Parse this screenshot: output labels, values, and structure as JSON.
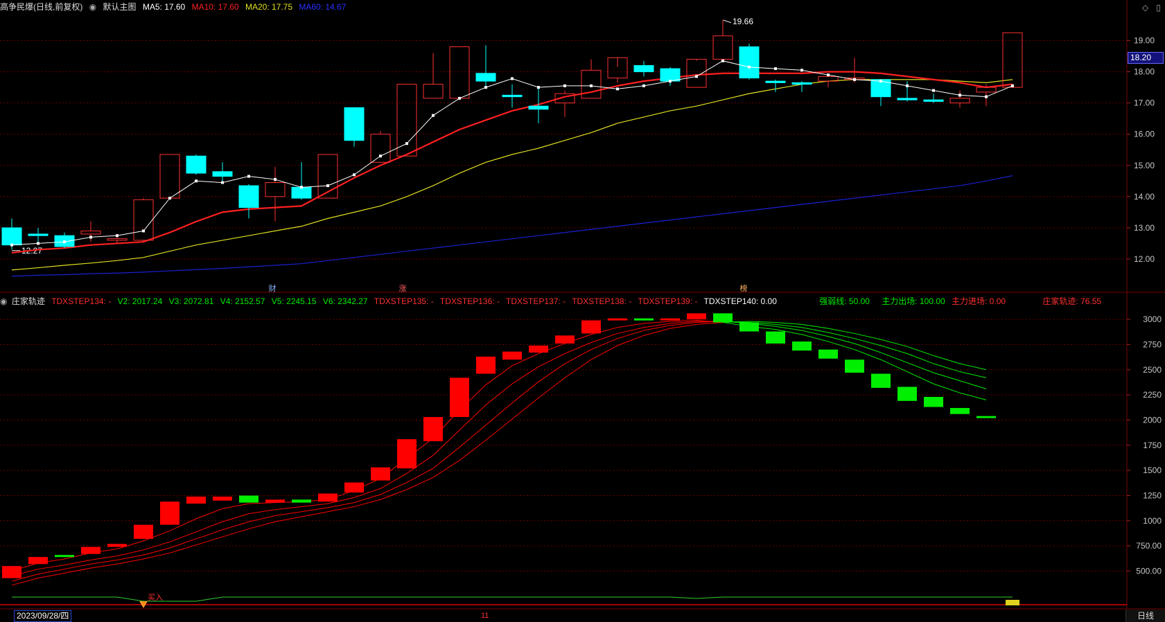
{
  "main_header": {
    "title": "高争民爆(日线,前复权)",
    "indicator_name": "默认主图",
    "ma5": "MA5: 17.60",
    "ma10": "MA10: 17.60",
    "ma20": "MA20: 17.75",
    "ma60": "MA60: 14.67"
  },
  "sub_header": {
    "title": "庄家轨迹",
    "step134": "TDXSTEP134: -",
    "v2": "V2: 2017.24",
    "v3": "V3: 2072.81",
    "v4": "V4: 2152.57",
    "v5": "V5: 2245.15",
    "v6": "V6: 2342.27",
    "step135": "TDXSTEP135: -",
    "step136": "TDXSTEP136: -",
    "step137": "TDXSTEP137: -",
    "step138": "TDXSTEP138: -",
    "step139": "TDXSTEP139: -",
    "step140": "TDXSTEP140: 0.00",
    "qrx": "强弱线: 50.00",
    "zlcc": "主力出场: 100.00",
    "zljc": "主力进场: 0.00",
    "zjgj": "庄家轨迹: 76.55"
  },
  "price_tag": "18.20",
  "high_label": "19.66",
  "low_label": "12.27",
  "events": [
    "财",
    "涨",
    "榜"
  ],
  "buy_marker": "买入",
  "date_label": "2023/09/28/四",
  "month_marker": "11",
  "period_tab": "日线",
  "colors": {
    "up": "#ff3030",
    "down": "#00ffff",
    "ma5": "#ffffff",
    "ma10": "#ff2020",
    "ma20": "#e0e020",
    "ma60": "#1a20d0",
    "sub_up": "#ff0000",
    "sub_down": "#00ee00"
  },
  "chart_data": {
    "type": "candlestick",
    "main": {
      "ylim": [
        11.2,
        19.9
      ],
      "yticks": [
        "12.00",
        "13.00",
        "14.00",
        "15.00",
        "16.00",
        "17.00",
        "18.00",
        "19.00"
      ],
      "candles": [
        [
          13.0,
          13.3,
          12.3,
          12.45
        ],
        [
          12.8,
          13.0,
          12.55,
          12.75
        ],
        [
          12.75,
          12.85,
          12.35,
          12.4
        ],
        [
          12.8,
          13.2,
          12.55,
          12.9
        ],
        [
          12.6,
          12.75,
          12.5,
          12.65
        ],
        [
          12.6,
          13.95,
          12.55,
          13.9
        ],
        [
          13.95,
          15.35,
          13.95,
          15.35
        ],
        [
          15.3,
          15.35,
          14.7,
          14.75
        ],
        [
          14.8,
          15.1,
          14.5,
          14.65
        ],
        [
          14.35,
          14.4,
          13.3,
          13.65
        ],
        [
          14.0,
          14.95,
          13.2,
          14.45
        ],
        [
          14.3,
          15.1,
          13.9,
          13.95
        ],
        [
          13.95,
          15.35,
          13.95,
          15.35
        ],
        [
          16.85,
          16.85,
          15.6,
          15.8
        ],
        [
          15.1,
          16.1,
          15.1,
          16.0
        ],
        [
          15.3,
          17.6,
          15.3,
          17.6
        ],
        [
          17.15,
          18.6,
          17.15,
          17.6
        ],
        [
          17.15,
          18.8,
          17.15,
          18.8
        ],
        [
          17.95,
          18.85,
          17.55,
          17.7
        ],
        [
          17.25,
          17.6,
          16.85,
          17.2
        ],
        [
          16.9,
          17.5,
          16.35,
          16.8
        ],
        [
          17.0,
          17.4,
          16.55,
          17.3
        ],
        [
          17.15,
          18.4,
          17.15,
          18.05
        ],
        [
          17.8,
          18.15,
          17.65,
          18.45
        ],
        [
          18.2,
          18.35,
          17.85,
          18.0
        ],
        [
          18.1,
          18.15,
          17.55,
          17.7
        ],
        [
          17.5,
          18.35,
          17.5,
          18.4
        ],
        [
          18.4,
          19.66,
          18.4,
          19.15
        ],
        [
          18.8,
          18.9,
          17.75,
          17.8
        ],
        [
          17.7,
          17.75,
          17.35,
          17.65
        ],
        [
          17.65,
          17.7,
          17.35,
          17.6
        ],
        [
          17.7,
          17.85,
          17.5,
          17.85
        ],
        [
          17.75,
          18.45,
          17.65,
          17.8
        ],
        [
          17.75,
          17.75,
          16.9,
          17.2
        ],
        [
          17.15,
          17.7,
          17.05,
          17.1
        ],
        [
          17.1,
          17.3,
          17.0,
          17.05
        ],
        [
          17.0,
          17.4,
          16.85,
          17.15
        ],
        [
          17.35,
          17.6,
          16.9,
          17.5
        ],
        [
          17.5,
          19.25,
          17.5,
          19.25
        ]
      ],
      "ma5": [
        12.45,
        12.5,
        12.55,
        12.7,
        12.75,
        12.9,
        13.95,
        14.5,
        14.45,
        14.65,
        14.55,
        14.3,
        14.35,
        14.7,
        15.3,
        15.7,
        16.6,
        17.15,
        17.5,
        17.78,
        17.5,
        17.55,
        17.55,
        17.45,
        17.55,
        17.7,
        17.85,
        18.35,
        18.15,
        18.1,
        18.05,
        17.9,
        17.75,
        17.7,
        17.55,
        17.4,
        17.25,
        17.2,
        17.55
      ],
      "ma10": [
        12.2,
        12.3,
        12.35,
        12.45,
        12.5,
        12.55,
        12.85,
        13.2,
        13.5,
        13.6,
        13.65,
        13.7,
        14.15,
        14.6,
        15.0,
        15.35,
        15.75,
        16.15,
        16.45,
        16.75,
        16.95,
        17.2,
        17.35,
        17.55,
        17.7,
        17.8,
        17.9,
        17.95,
        17.95,
        17.95,
        17.95,
        18.0,
        18.0,
        17.95,
        17.85,
        17.75,
        17.65,
        17.5,
        17.6
      ],
      "ma20": [
        11.65,
        11.72,
        11.8,
        11.87,
        11.95,
        12.05,
        12.25,
        12.45,
        12.6,
        12.75,
        12.9,
        13.05,
        13.3,
        13.5,
        13.7,
        14.0,
        14.35,
        14.75,
        15.1,
        15.35,
        15.55,
        15.8,
        16.05,
        16.35,
        16.55,
        16.75,
        16.9,
        17.1,
        17.3,
        17.45,
        17.6,
        17.7,
        17.75,
        17.75,
        17.75,
        17.75,
        17.7,
        17.65,
        17.75
      ],
      "ma60": [
        11.45,
        11.48,
        11.5,
        11.53,
        11.55,
        11.58,
        11.62,
        11.66,
        11.7,
        11.75,
        11.8,
        11.85,
        11.95,
        12.05,
        12.15,
        12.25,
        12.35,
        12.45,
        12.55,
        12.65,
        12.75,
        12.85,
        12.95,
        13.05,
        13.15,
        13.25,
        13.35,
        13.45,
        13.55,
        13.65,
        13.75,
        13.85,
        13.95,
        14.05,
        14.15,
        14.25,
        14.35,
        14.5,
        14.67
      ]
    },
    "sub": {
      "ylim": [
        290,
        3090
      ],
      "yticks": [
        "500.00",
        "750.00",
        "1000",
        "1250",
        "1500",
        "1750",
        "2000",
        "2250",
        "2500",
        "2750",
        "3000"
      ],
      "blocks": [
        [
          430,
          550,
          "up"
        ],
        [
          570,
          640,
          "up"
        ],
        [
          640,
          660,
          "down"
        ],
        [
          670,
          740,
          "up"
        ],
        [
          740,
          770,
          "up"
        ],
        [
          820,
          960,
          "up"
        ],
        [
          960,
          1190,
          "up"
        ],
        [
          1170,
          1240,
          "up"
        ],
        [
          1200,
          1240,
          "up"
        ],
        [
          1180,
          1250,
          "down"
        ],
        [
          1180,
          1210,
          "up"
        ],
        [
          1180,
          1210,
          "down"
        ],
        [
          1190,
          1270,
          "up"
        ],
        [
          1280,
          1380,
          "up"
        ],
        [
          1400,
          1530,
          "up"
        ],
        [
          1520,
          1810,
          "up"
        ],
        [
          1790,
          2030,
          "up"
        ],
        [
          2030,
          2420,
          "up"
        ],
        [
          2460,
          2630,
          "up"
        ],
        [
          2600,
          2680,
          "up"
        ],
        [
          2670,
          2740,
          "up"
        ],
        [
          2760,
          2840,
          "up"
        ],
        [
          2860,
          2990,
          "up"
        ],
        [
          2990,
          3010,
          "up"
        ],
        [
          2990,
          3010,
          "down"
        ],
        [
          2990,
          3010,
          "up"
        ],
        [
          3000,
          3060,
          "up"
        ],
        [
          2970,
          3060,
          "down"
        ],
        [
          2880,
          2970,
          "down"
        ],
        [
          2760,
          2880,
          "down"
        ],
        [
          2690,
          2780,
          "down"
        ],
        [
          2610,
          2700,
          "down"
        ],
        [
          2470,
          2600,
          "down"
        ],
        [
          2320,
          2460,
          "down"
        ],
        [
          2190,
          2330,
          "down"
        ],
        [
          2130,
          2230,
          "down"
        ],
        [
          2060,
          2120,
          "down"
        ],
        [
          2020,
          2040,
          "down"
        ]
      ],
      "lines": [
        [
          500,
          580,
          620,
          680,
          720,
          800,
          900,
          1020,
          1120,
          1170,
          1180,
          1190,
          1210,
          1300,
          1420,
          1620,
          1820,
          2100,
          2350,
          2540,
          2660,
          2760,
          2850,
          2920,
          2960,
          2980,
          2990,
          2970,
          2930,
          2900,
          2850,
          2780,
          2700,
          2600,
          2480,
          2360,
          2270,
          2200
        ],
        [
          450,
          520,
          560,
          610,
          650,
          710,
          790,
          890,
          990,
          1070,
          1110,
          1140,
          1170,
          1230,
          1320,
          1470,
          1650,
          1900,
          2150,
          2360,
          2530,
          2660,
          2770,
          2860,
          2920,
          2960,
          2980,
          2980,
          2960,
          2930,
          2890,
          2830,
          2760,
          2670,
          2570,
          2470,
          2390,
          2310
        ],
        [
          400,
          470,
          520,
          570,
          610,
          660,
          730,
          820,
          910,
          990,
          1050,
          1090,
          1130,
          1180,
          1260,
          1380,
          1520,
          1730,
          1950,
          2170,
          2380,
          2560,
          2700,
          2810,
          2890,
          2940,
          2970,
          2980,
          2970,
          2950,
          2920,
          2870,
          2810,
          2740,
          2660,
          2560,
          2480,
          2420
        ],
        [
          360,
          430,
          480,
          530,
          570,
          620,
          680,
          760,
          840,
          920,
          990,
          1040,
          1090,
          1140,
          1210,
          1310,
          1430,
          1600,
          1800,
          2010,
          2220,
          2420,
          2600,
          2740,
          2840,
          2910,
          2950,
          2970,
          2980,
          2970,
          2950,
          2910,
          2860,
          2800,
          2730,
          2640,
          2560,
          2500
        ]
      ]
    }
  }
}
